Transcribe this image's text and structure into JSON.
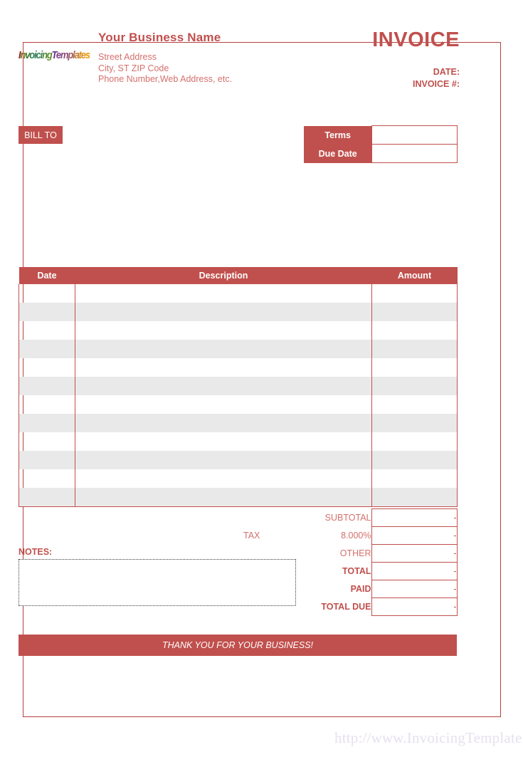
{
  "document": {
    "title": "INVOICE",
    "accent_color": "#c0504d",
    "accent_light_color": "#d4706c",
    "row_stripe_color": "#e9e9e9",
    "watermark": "http://www.InvoicingTemplate.com"
  },
  "logo": {
    "text": "InvoicingTemplates",
    "letters": [
      {
        "ch": "I",
        "color": "#8c1a14"
      },
      {
        "ch": "n",
        "color": "#6b7a1f"
      },
      {
        "ch": "v",
        "color": "#3f7a33"
      },
      {
        "ch": "o",
        "color": "#2f7a4a"
      },
      {
        "ch": "i",
        "color": "#2a7a63"
      },
      {
        "ch": "c",
        "color": "#2f7f55"
      },
      {
        "ch": "i",
        "color": "#3d8347"
      },
      {
        "ch": "n",
        "color": "#4f8a3a"
      },
      {
        "ch": "g",
        "color": "#5f8f2e"
      },
      {
        "ch": "T",
        "color": "#6a2f8a"
      },
      {
        "ch": "e",
        "color": "#7a3a85"
      },
      {
        "ch": "m",
        "color": "#8a4a7a"
      },
      {
        "ch": "p",
        "color": "#9b5a63"
      },
      {
        "ch": "l",
        "color": "#b06a45"
      },
      {
        "ch": "a",
        "color": "#c47a2a"
      },
      {
        "ch": "t",
        "color": "#d4881a"
      },
      {
        "ch": "e",
        "color": "#e08f12"
      },
      {
        "ch": "s",
        "color": "#ef9a0a"
      }
    ]
  },
  "business": {
    "name": "Your Business Name",
    "address_lines": [
      "Street Address",
      "City, ST  ZIP Code",
      "Phone Number,Web Address, etc."
    ]
  },
  "meta": {
    "date_label": "DATE:",
    "invoice_no_label": "INVOICE #:",
    "date_value": "",
    "invoice_no_value": ""
  },
  "bill_to": {
    "badge_label": "BILL TO",
    "value": ""
  },
  "terms": {
    "rows": [
      {
        "label": "Terms",
        "value": ""
      },
      {
        "label": "Due Date",
        "value": ""
      }
    ]
  },
  "items_table": {
    "columns": [
      "Date",
      "Description",
      "Amount"
    ],
    "row_count": 12,
    "rows": [
      {
        "date": "",
        "description": "",
        "amount": ""
      },
      {
        "date": "",
        "description": "",
        "amount": ""
      },
      {
        "date": "",
        "description": "",
        "amount": ""
      },
      {
        "date": "",
        "description": "",
        "amount": ""
      },
      {
        "date": "",
        "description": "",
        "amount": ""
      },
      {
        "date": "",
        "description": "",
        "amount": ""
      },
      {
        "date": "",
        "description": "",
        "amount": ""
      },
      {
        "date": "",
        "description": "",
        "amount": ""
      },
      {
        "date": "",
        "description": "",
        "amount": ""
      },
      {
        "date": "",
        "description": "",
        "amount": ""
      },
      {
        "date": "",
        "description": "",
        "amount": ""
      },
      {
        "date": "",
        "description": "",
        "amount": ""
      }
    ]
  },
  "notes": {
    "label": "NOTES:",
    "value": ""
  },
  "totals": {
    "tax_word": "TAX",
    "rows": [
      {
        "label": "SUBTOTAL",
        "value": "-",
        "bold": false,
        "tax_word": ""
      },
      {
        "label": "8.000%",
        "value": "-",
        "bold": false,
        "tax_word": "TAX"
      },
      {
        "label": "OTHER",
        "value": "-",
        "bold": false,
        "tax_word": ""
      },
      {
        "label": "TOTAL",
        "value": "-",
        "bold": true,
        "tax_word": ""
      },
      {
        "label": "PAID",
        "value": "-",
        "bold": true,
        "tax_word": ""
      },
      {
        "label": "TOTAL DUE",
        "value": "-",
        "bold": true,
        "tax_word": ""
      }
    ]
  },
  "footer": {
    "message": "THANK YOU FOR YOUR BUSINESS!"
  }
}
